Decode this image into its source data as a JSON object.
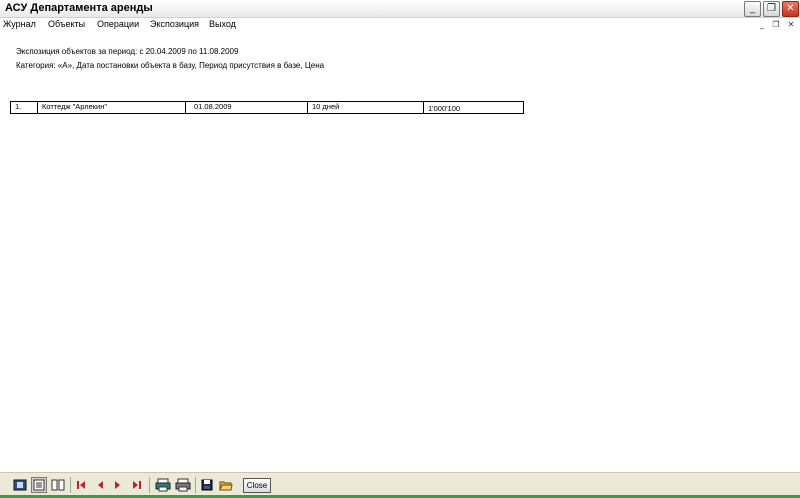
{
  "window": {
    "title": "АСУ Департамента аренды"
  },
  "menu": {
    "items": [
      "Журнал",
      "Объекты",
      "Операции",
      "Экспозиция",
      "Выход"
    ]
  },
  "report": {
    "header_line": "Экспозиция объектов за период: с 20.04.2009 по 11.08.2009",
    "category_line": "Категория: «А», Дата постановки объекта в базу, Период присутствия в базе, Цена",
    "rows": [
      {
        "num": "1.",
        "name": "Коттедж \"Арлекин\"",
        "date": "01.08.2009",
        "period": "10 дней",
        "price": "1'000'100"
      }
    ]
  },
  "toolbar": {
    "close_label": "Close"
  },
  "colors": {
    "accent_green": "#2ba34b",
    "title_close": "#c2371c",
    "nav_arrow": "#c0202a"
  }
}
